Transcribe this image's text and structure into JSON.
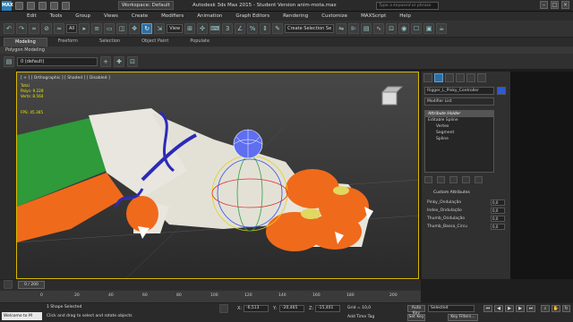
{
  "title_bar": {
    "workspace": "Workspace: Default",
    "title": "Autodesk 3ds Max 2015  -  Student Version    anim-mota.max",
    "search_placeholder": "Type a keyword or phrase"
  },
  "menu": [
    "Edit",
    "Tools",
    "Group",
    "Views",
    "Create",
    "Modifiers",
    "Animation",
    "Graph Editors",
    "Rendering",
    "Customize",
    "MAXScript",
    "Help"
  ],
  "toolbar": {
    "selection_filter": "All",
    "ref_coord": "View",
    "named_selection": "Create Selection Se"
  },
  "ribbon": {
    "tabs": [
      "Modeling",
      "Freeform",
      "Selection",
      "Object Paint",
      "Populate"
    ],
    "subpanel": "Polygon Modeling"
  },
  "layer": {
    "current": "0 (default)"
  },
  "viewport": {
    "label": "[ + ] [ Orthographic ] [ Shaded ]  [ Disabled ]",
    "stats": {
      "total_label": "Total",
      "polys_label": "Polys:",
      "polys_value": "9.228",
      "verts_label": "Verts:",
      "verts_value": "8.564",
      "fps_label": "FPS:",
      "fps_value": "45.365"
    }
  },
  "command_panel": {
    "object_name": "Rigger_L_Pinky_Controller",
    "modifier_list": "Modifier List",
    "stack": [
      {
        "label": "Attribute Holder",
        "selected": true,
        "sub": false
      },
      {
        "label": "Editable Spline",
        "selected": false,
        "sub": false
      },
      {
        "label": "Vertex",
        "selected": false,
        "sub": true
      },
      {
        "label": "Segment",
        "selected": false,
        "sub": true
      },
      {
        "label": "Spline",
        "selected": false,
        "sub": true
      }
    ],
    "rollout_title": "Custom Attributes",
    "params": [
      {
        "label": "Pinky_Ondulação",
        "value": "0,0"
      },
      {
        "label": "Index_Ondulação",
        "value": "0,0"
      },
      {
        "label": "Thumb_Ondulação",
        "value": "0,0"
      },
      {
        "label": "Thumb_Bassa_Circu",
        "value": "0,0"
      }
    ]
  },
  "timeline": {
    "frame": "0 / 200",
    "ticks": [
      "0",
      "20",
      "40",
      "60",
      "80",
      "100",
      "120",
      "140",
      "160",
      "180",
      "200"
    ]
  },
  "status": {
    "welcome": "Welcome to M",
    "selection": "1 Shape Selected",
    "prompt": "Click and drag to select and rotate objects",
    "x_label": "X:",
    "x_value": "-6,513",
    "y_label": "Y:",
    "y_value": "-20,465",
    "z_label": "Z:",
    "z_value": "-15,401",
    "grid": "Grid = 10,0",
    "add_time_tag": "Add Time Tag",
    "auto_key": "Auto Key",
    "key_mode": "Selected",
    "set_key": "Set Key",
    "key_filters": "Key Filters..."
  },
  "colors": {
    "accent": "#2f6ea0",
    "viewport_border": "#d8b800",
    "stats_text": "#e8e800",
    "hand_green": "#2e9a3a",
    "hand_orange": "#f06a1c"
  }
}
